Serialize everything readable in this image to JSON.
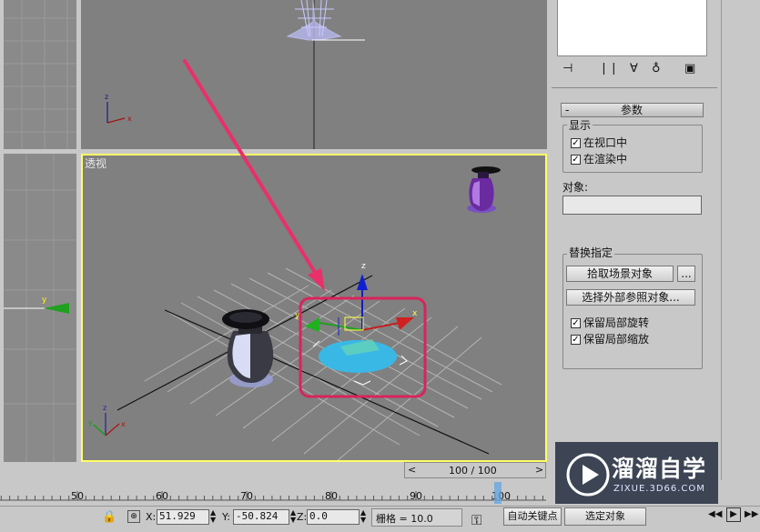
{
  "viewports": {
    "perspective_label": "透视",
    "axis_z": "z",
    "axis_x": "x",
    "axis_y": "y"
  },
  "command_panel": {
    "rollout_toggle": "-",
    "rollout_title": "参数",
    "display_group": {
      "title": "显示",
      "in_viewport": "在视口中",
      "in_viewport_checked": true,
      "in_render": "在渲染中",
      "in_render_checked": true
    },
    "object_label": "对象:",
    "object_value": "",
    "replace_group": {
      "title": "替换指定",
      "pick_scene_object": "拾取场景对象",
      "more": "...",
      "select_xref_object": "选择外部参照对象...",
      "keep_local_rotation": "保留局部旋转",
      "keep_local_rotation_checked": true,
      "keep_local_scale": "保留局部缩放",
      "keep_local_scale_checked": true
    }
  },
  "timeline": {
    "frame_display": "100 / 100",
    "prev": "<",
    "next": ">",
    "ticks": [
      "50",
      "60",
      "70",
      "80",
      "90",
      "100"
    ]
  },
  "statusbar": {
    "x_label": "X:",
    "x_value": "51.929",
    "y_label": "Y:",
    "y_value": "-50.824",
    "z_label": "Z:",
    "z_value": "0.0",
    "grid_label": "栅格 = 10.0",
    "auto_key": "自动关键点",
    "selected_object": "选定对象"
  },
  "watermark": {
    "title": "溜溜自学",
    "url": "ZIXUE.3D66.COM"
  },
  "colors": {
    "viewport_bg": "#808080",
    "active_border": "#ffff66",
    "arrow": "#e8306a",
    "highlight_box": "#d8245c",
    "selection_disc": "#39b8e6"
  }
}
